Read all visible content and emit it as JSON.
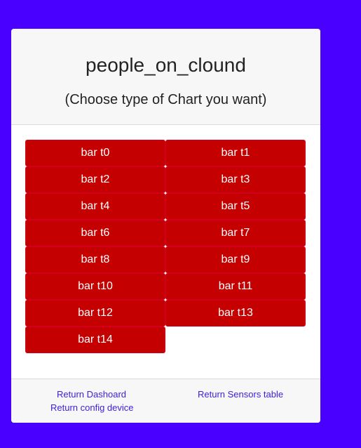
{
  "header": {
    "title": "people_on_clound",
    "subtitle": "(Choose type of Chart you want)"
  },
  "chart_buttons": [
    "bar t0",
    "bar t1",
    "bar t2",
    "bar t3",
    "bar t4",
    "bar t5",
    "bar t6",
    "bar t7",
    "bar t8",
    "bar t9",
    "bar t10",
    "bar t11",
    "bar t12",
    "bar t13",
    "bar t14"
  ],
  "footer": {
    "dashboard_link": "Return Dashoard",
    "sensors_link": "Return Sensors table",
    "config_link": "Return config device"
  },
  "colors": {
    "background": "#4a00ff",
    "button": "#c40000",
    "link": "#3b1de0"
  }
}
